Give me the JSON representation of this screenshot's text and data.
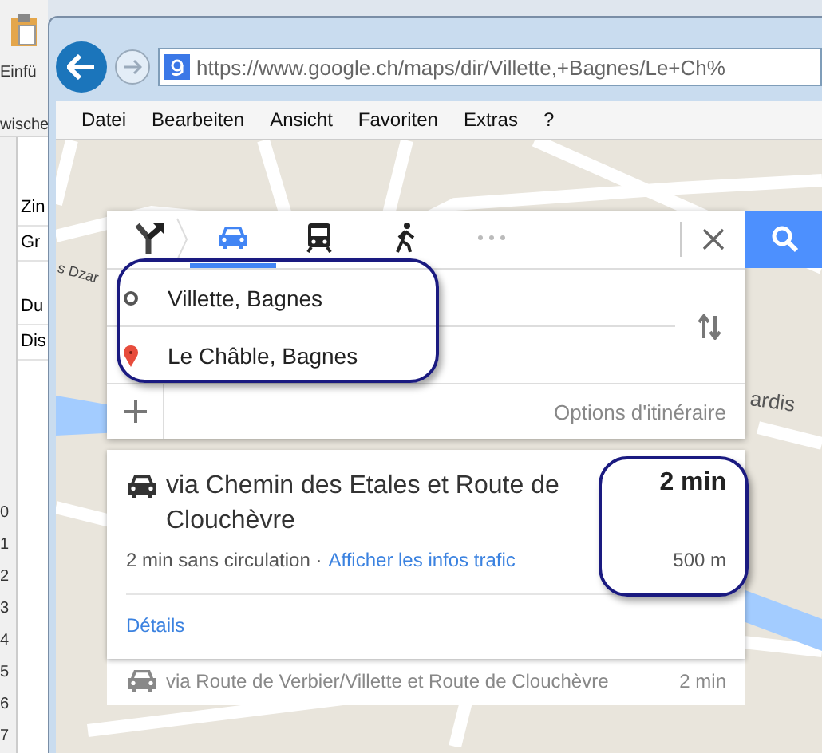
{
  "background_app": {
    "ribbon_labels": [
      "Einfü",
      "wische"
    ],
    "cells": [
      "Zin",
      "Gr",
      "Du",
      "Dis"
    ],
    "row_numbers": [
      "0",
      "1",
      "2",
      "3",
      "4",
      "5",
      "6",
      "7"
    ]
  },
  "browser": {
    "url": "https://www.google.ch/maps/dir/Villette,+Bagnes/Le+Ch%",
    "menu": [
      "Datei",
      "Bearbeiten",
      "Ansicht",
      "Favoriten",
      "Extras",
      "?"
    ]
  },
  "map": {
    "labels": [
      "s Dzar",
      "ardis"
    ]
  },
  "directions": {
    "modes": [
      {
        "kind": "best",
        "selected": false
      },
      {
        "kind": "car",
        "selected": true
      },
      {
        "kind": "transit",
        "selected": false
      },
      {
        "kind": "walk",
        "selected": false
      },
      {
        "kind": "more",
        "selected": false
      }
    ],
    "waypoints": [
      {
        "kind": "origin",
        "value": "Villette, Bagnes"
      },
      {
        "kind": "destination",
        "value": "Le Châble, Bagnes"
      }
    ],
    "options_label": "Options d'itinéraire",
    "routes": [
      {
        "selected": true,
        "title": "via Chemin des Etales et Route de Clouchèvre",
        "duration": "2 min",
        "traffic_note": "2 min sans circulation ·",
        "traffic_link": "Afficher les infos trafic",
        "distance": "500 m",
        "details_link": "Détails"
      },
      {
        "selected": false,
        "title": "via Route de Verbier/Villette et Route de Clouchèvre",
        "duration": "2 min"
      }
    ]
  }
}
